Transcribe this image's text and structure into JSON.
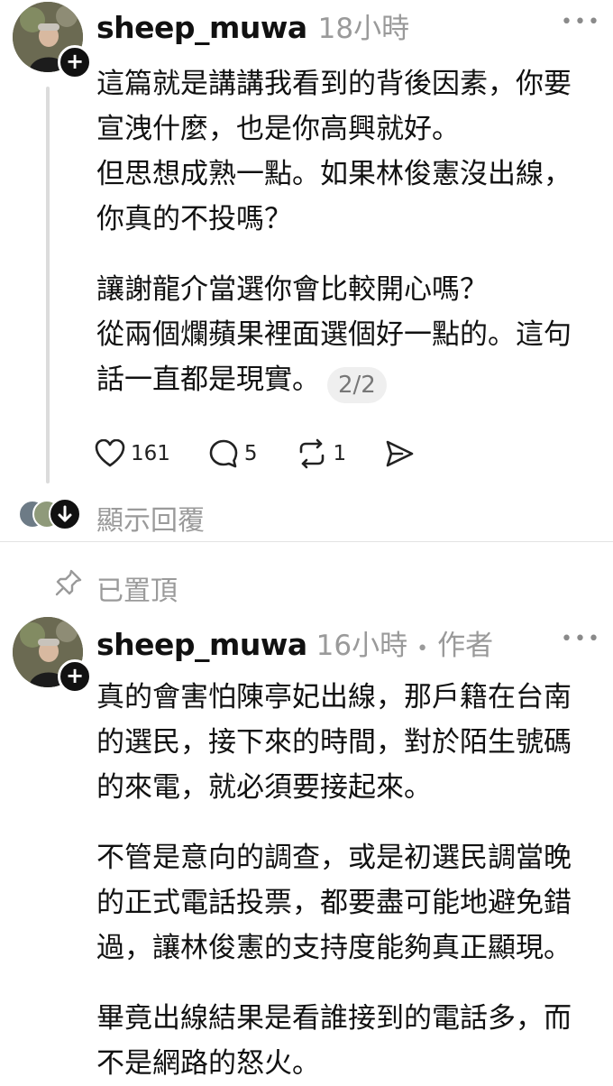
{
  "post1": {
    "username": "sheep_muwa",
    "time": "18小時",
    "more_label": "•••",
    "paragraphs": [
      "這篇就是講講我看到的背後因素，你要\n宣洩什麼，也是你高興就好。\n但思想成熟一點。如果林俊憲沒出線，\n你真的不投嗎？",
      "讓謝龍介當選你會比較開心嗎？",
      "從兩個爛蘋果裡面選個好一點的。這句\n話一直都是現實。"
    ],
    "page_indicator": "2/2",
    "likes": "161",
    "comments": "5",
    "reposts": "1"
  },
  "replies": {
    "label": "顯示回覆"
  },
  "pinned": {
    "label": "已置頂"
  },
  "post2": {
    "username": "sheep_muwa",
    "time": "16小時",
    "separator": "•",
    "author_tag": "作者",
    "more_label": "•••",
    "paragraphs": [
      "真的會害怕陳亭妃出線，那戶籍在台南\n的選民，接下來的時間，對於陌生號碼\n的來電，就必須要接起來。",
      "不管是意向的調查，或是初選民調當晚\n的正式電話投票，都要盡可能地避免錯\n過，讓林俊憲的支持度能夠真正顯現。",
      "畢竟出線結果是看誰接到的電話多，而\n不是網路的怒火。"
    ]
  },
  "icons": {
    "follow": "plus-icon",
    "like": "heart-icon",
    "comment": "comment-icon",
    "repost": "repost-icon",
    "share": "send-icon",
    "pin": "pin-icon",
    "expand": "arrow-down-icon"
  }
}
